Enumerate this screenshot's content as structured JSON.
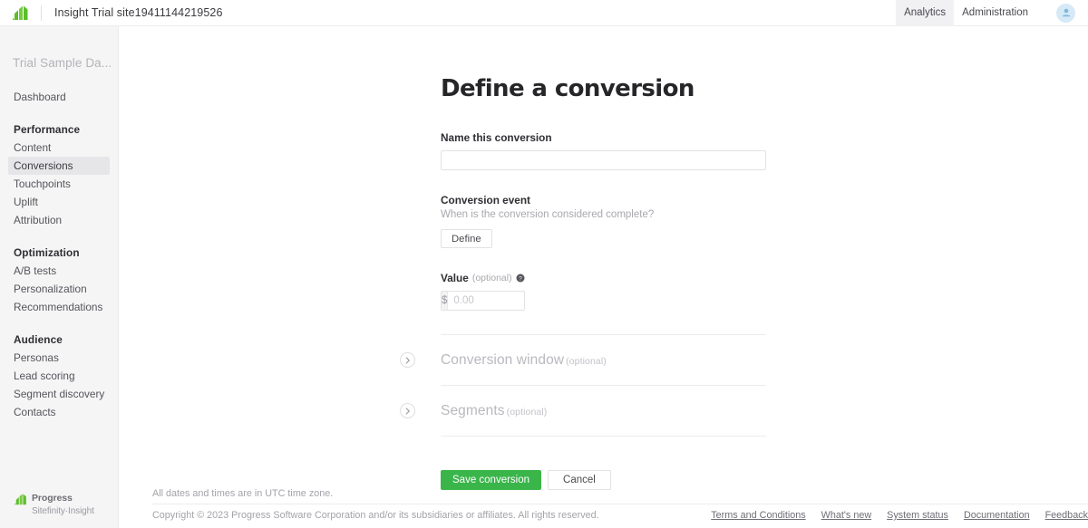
{
  "topbar": {
    "logo_icon": "progress-logo-icon",
    "site_title": "Insight Trial site19411144219526",
    "nav": [
      {
        "label": "Analytics",
        "active": true
      },
      {
        "label": "Administration",
        "active": false
      }
    ],
    "avatar_icon": "user-avatar-icon"
  },
  "sidebar": {
    "site_name": "Trial Sample Da...",
    "items": [
      {
        "type": "link",
        "label": "Dashboard",
        "selected": false
      },
      {
        "type": "group",
        "label": "Performance"
      },
      {
        "type": "link",
        "label": "Content",
        "selected": false
      },
      {
        "type": "link",
        "label": "Conversions",
        "selected": true
      },
      {
        "type": "link",
        "label": "Touchpoints",
        "selected": false
      },
      {
        "type": "link",
        "label": "Uplift",
        "selected": false
      },
      {
        "type": "link",
        "label": "Attribution",
        "selected": false
      },
      {
        "type": "group",
        "label": "Optimization"
      },
      {
        "type": "link",
        "label": "A/B tests",
        "selected": false
      },
      {
        "type": "link",
        "label": "Personalization",
        "selected": false
      },
      {
        "type": "link",
        "label": "Recommendations",
        "selected": false
      },
      {
        "type": "group",
        "label": "Audience"
      },
      {
        "type": "link",
        "label": "Personas",
        "selected": false
      },
      {
        "type": "link",
        "label": "Lead scoring",
        "selected": false
      },
      {
        "type": "link",
        "label": "Segment discovery",
        "selected": false
      },
      {
        "type": "link",
        "label": "Contacts",
        "selected": false
      }
    ],
    "logo": {
      "icon": "progress-logo-icon",
      "primary": "Progress",
      "secondary": "Sitefinity·Insight"
    }
  },
  "main": {
    "title": "Define a conversion",
    "name_field": {
      "label": "Name this conversion",
      "value": "",
      "placeholder": ""
    },
    "conversion_event": {
      "label": "Conversion event",
      "hint": "When is the conversion considered complete?",
      "button_label": "Define"
    },
    "value_field": {
      "label": "Value",
      "optional": "(optional)",
      "help_icon": "help-circle-icon",
      "currency_symbol": "$",
      "value": "",
      "placeholder": "0.00"
    },
    "collapsible_sections": [
      {
        "title": "Conversion window",
        "optional": "(optional)",
        "chevron_icon": "chevron-right-icon",
        "expanded": false
      },
      {
        "title": "Segments",
        "optional": "(optional)",
        "chevron_icon": "chevron-right-icon",
        "expanded": false
      }
    ],
    "actions": {
      "save_label": "Save conversion",
      "cancel_label": "Cancel",
      "save_color": "#3ab54a"
    }
  },
  "footer": {
    "timezone_note": "All dates and times are in UTC time zone.",
    "copyright": "Copyright © 2023 Progress Software Corporation and/or its subsidiaries or affiliates. All rights reserved.",
    "links": [
      "Terms and Conditions",
      "What's new",
      "System status",
      "Documentation",
      "Feedback"
    ]
  },
  "colors": {
    "brand_green": "#3ab54a",
    "sidebar_bg": "#f5f5f6",
    "border": "#ececee",
    "avatar_bg": "#d6e9f7"
  }
}
